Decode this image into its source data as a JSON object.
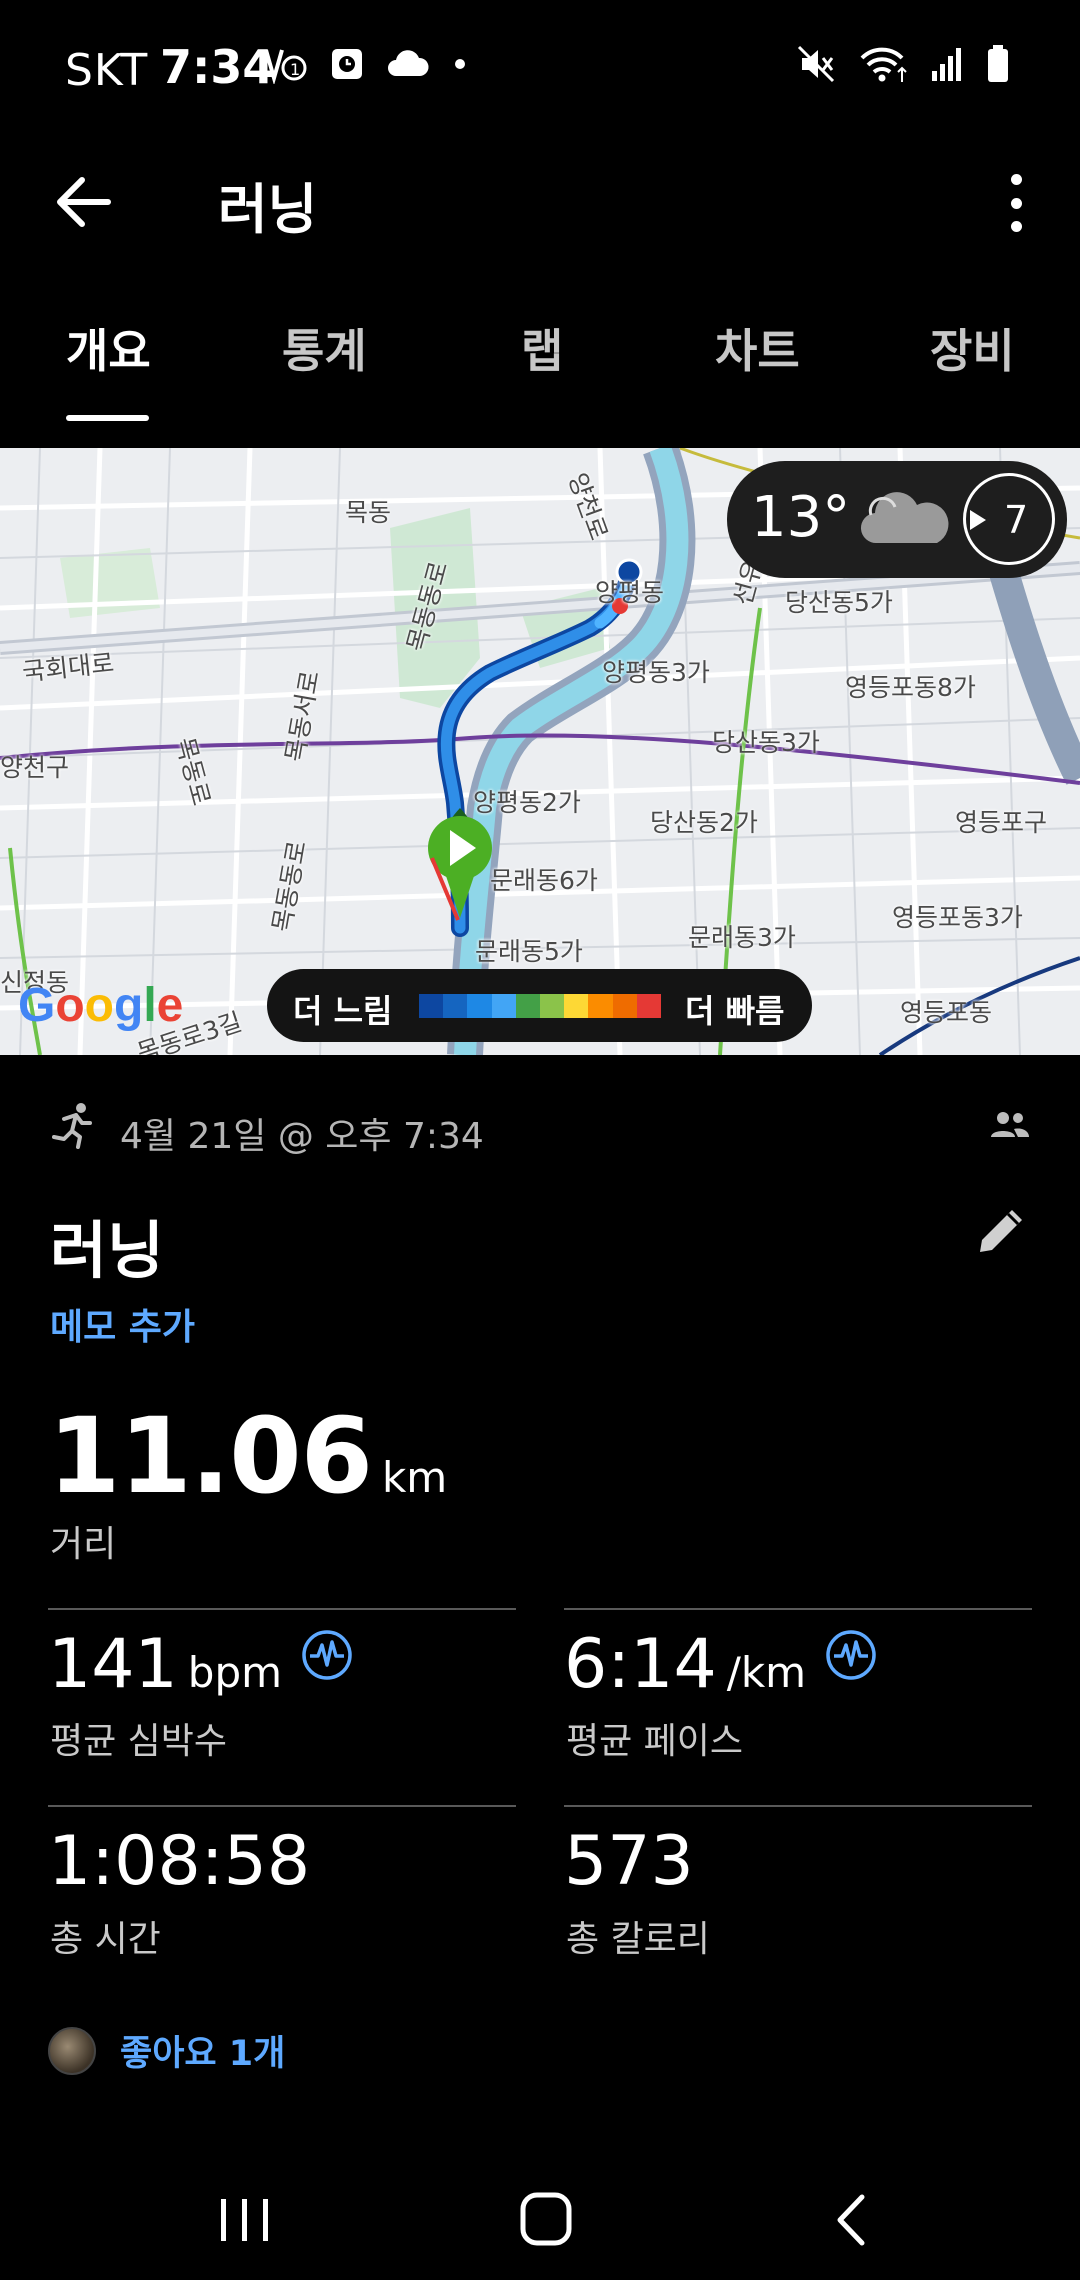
{
  "status_bar": {
    "carrier": "SKT",
    "time": "7:34",
    "left_icons": [
      "volte-icon",
      "alarm-icon",
      "cloud-icon",
      "dot-icon"
    ],
    "right_icons": [
      "mute-icon",
      "wifi-icon",
      "signal-icon",
      "battery-icon"
    ]
  },
  "header": {
    "title": "러닝",
    "back_icon": "arrow-back-icon",
    "more_icon": "more-vert-icon"
  },
  "tabs": [
    {
      "label": "개요",
      "active": true
    },
    {
      "label": "통계",
      "active": false
    },
    {
      "label": "랩",
      "active": false
    },
    {
      "label": "차트",
      "active": false
    },
    {
      "label": "장비",
      "active": false
    }
  ],
  "map": {
    "labels": [
      "목동",
      "양천로",
      "양평동",
      "당산동5가",
      "국회대로",
      "목동동로",
      "양평동3가",
      "영등포동8가",
      "목동서로",
      "양천구",
      "목동로",
      "당산동3가",
      "양평동2가",
      "당산동2가",
      "영등포구",
      "문래동6가",
      "목동동로",
      "문래동3가",
      "영등포동3가",
      "문래동5가",
      "신정동",
      "영등포동",
      "목동로3길",
      "선유로"
    ],
    "weather": {
      "temperature": "13°",
      "aqi": "7"
    },
    "legend": {
      "slow": "더 느림",
      "fast": "더 빠름",
      "colors": [
        "#0d47a1",
        "#1565c0",
        "#1e88e5",
        "#42a5f5",
        "#43a047",
        "#8bc34a",
        "#fdd835",
        "#fb8c00",
        "#ef6c00",
        "#e53935"
      ]
    },
    "attribution": "Google"
  },
  "activity": {
    "date": "4월 21일 @ 오후 7:34",
    "title": "러닝",
    "memo_link": "메모 추가",
    "distance": {
      "value": "11.06",
      "unit": "km",
      "label": "거리"
    },
    "heart_rate": {
      "value": "141",
      "unit": "bpm",
      "label": "평균 심박수"
    },
    "pace": {
      "value": "6:14",
      "unit": "/km",
      "label": "평균 페이스"
    },
    "duration": {
      "value": "1:08:58",
      "label": "총 시간"
    },
    "calories": {
      "value": "573",
      "label": "총 칼로리"
    },
    "likes": "좋아요 1개"
  },
  "nav_bar": {
    "icons": [
      "recent-apps-icon",
      "home-icon",
      "back-icon"
    ]
  }
}
